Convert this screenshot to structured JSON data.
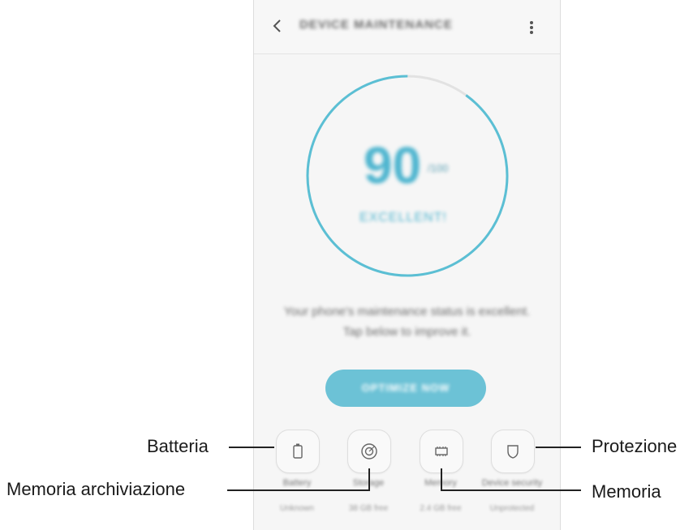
{
  "appbar": {
    "title": "DEVICE MAINTENANCE",
    "back_icon": "chevron-left-icon",
    "more_icon": "more-vertical-icon"
  },
  "gauge": {
    "score": "90",
    "unit": "/100",
    "status": "EXCELLENT!",
    "progress": 0.9,
    "accent_color": "#5bbfd4",
    "track_color": "#e2e2e2"
  },
  "message": {
    "line1": "Your phone's maintenance status is excellent.",
    "line2": "Tap below to improve it."
  },
  "optimize_button": {
    "label": "OPTIMIZE NOW",
    "color": "#6cc2d6"
  },
  "categories": [
    {
      "label": "Battery",
      "value": "Unknown",
      "icon": "battery-icon"
    },
    {
      "label": "Storage",
      "value": "38 GB free",
      "icon": "storage-icon"
    },
    {
      "label": "Memory",
      "value": "2.4 GB free",
      "icon": "memory-chip-icon"
    },
    {
      "label": "Device security",
      "value": "Unprotected",
      "icon": "shield-icon"
    }
  ],
  "callouts": {
    "batteria": "Batteria",
    "memoria_archiviazione": "Memoria archiviazione",
    "protezione": "Protezione",
    "memoria": "Memoria"
  }
}
